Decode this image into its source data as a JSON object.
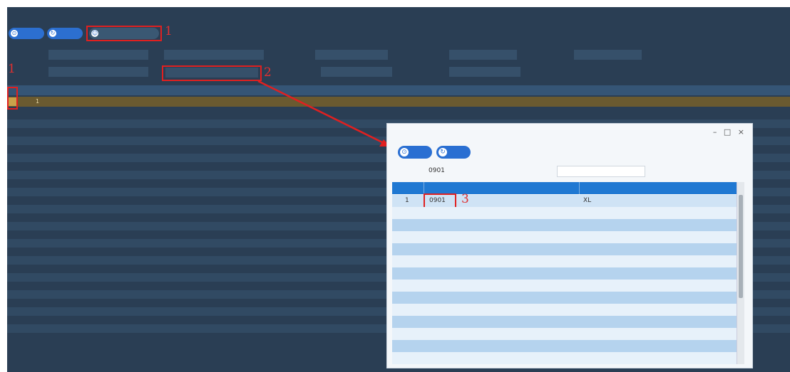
{
  "breadcrumb": "",
  "toolbar": {
    "query_label": "",
    "reset_label": "",
    "assign_label": "",
    "annotation_1": "1"
  },
  "filters": {
    "annotation_2": "2",
    "selected_user_value": ""
  },
  "grid": {
    "selected_row": {
      "rownum": "1",
      "code": "",
      "order_no": "",
      "type": "",
      "date": ""
    },
    "annotation_1": "1"
  },
  "pager": {
    "text": ""
  },
  "dialog": {
    "controls": "– □ ×",
    "query_label": "",
    "reset_label": "",
    "user_code_label": "",
    "user_code_value": "0901",
    "user_name_label": "",
    "user_name_value": "",
    "columns": [
      "",
      "",
      ""
    ],
    "rows": [
      {
        "num": "1",
        "code": "0901",
        "name": "XL"
      }
    ],
    "annotation_3": "3"
  },
  "colors": {
    "accent": "#2a6fd2",
    "highlight": "#e02020",
    "table_header": "#1f78d2",
    "row_odd": "#cfe3f5",
    "row_even": "#b5d3ee"
  }
}
